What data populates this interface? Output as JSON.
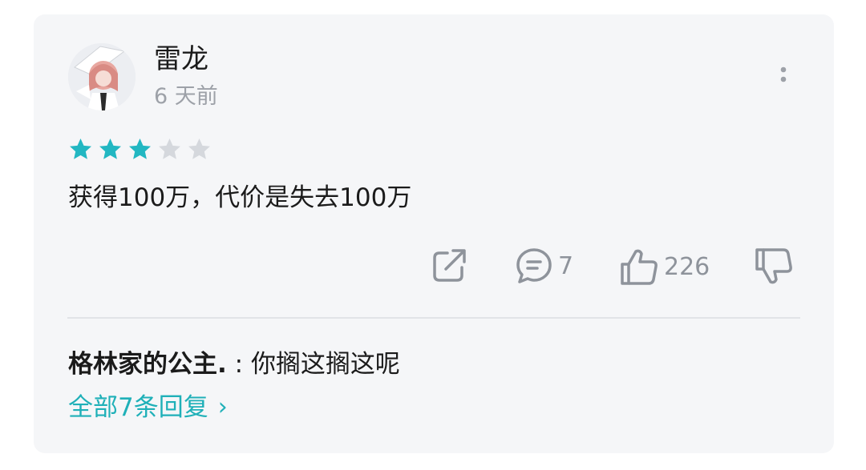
{
  "review": {
    "username": "雷龙",
    "time": "6 天前",
    "rating": 3,
    "max_rating": 5,
    "star_color": "#22b7c2",
    "star_empty_color": "#d5d8dd",
    "content": "获得100万，代价是失去100万"
  },
  "actions": {
    "share_icon": "share-icon",
    "comment_count": "7",
    "like_count": "226"
  },
  "reply": {
    "author": "格林家的公主.",
    "separator": " : ",
    "text": "你搁这搁这呢"
  },
  "all_replies": {
    "label": "全部7条回复",
    "chevron": "›",
    "color": "#1fb0b8"
  }
}
